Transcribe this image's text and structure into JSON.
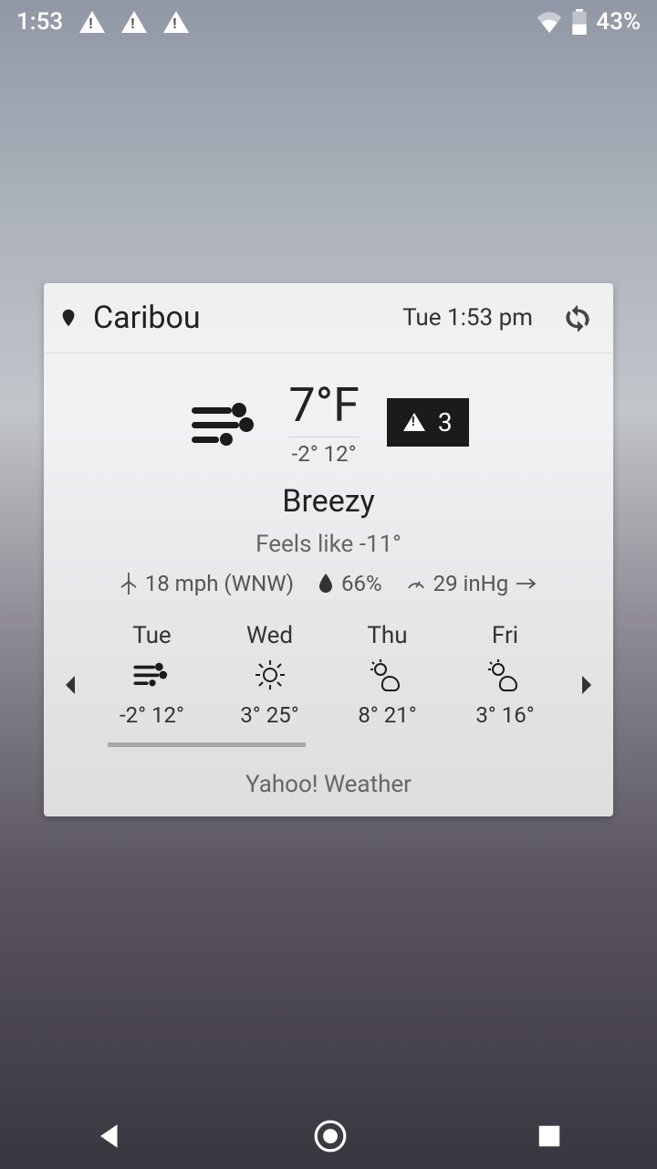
{
  "statusbar": {
    "time": "1:53",
    "battery": "43%"
  },
  "widget": {
    "location": "Caribou",
    "datetime": "Tue 1:53 pm",
    "temp": "7°F",
    "range_lo": "-2°",
    "range_hi": "12°",
    "alert_count": "3",
    "condition": "Breezy",
    "feels_like": "Feels like -11°",
    "wind": "18 mph (WNW)",
    "humidity": "66%",
    "pressure": "29 inHg",
    "provider": "Yahoo! Weather"
  },
  "forecast": [
    {
      "day": "Tue",
      "icon": "wind",
      "lo": "-2°",
      "hi": "12°"
    },
    {
      "day": "Wed",
      "icon": "sun",
      "lo": "3°",
      "hi": "25°"
    },
    {
      "day": "Thu",
      "icon": "partly",
      "lo": "8°",
      "hi": "21°"
    },
    {
      "day": "Fri",
      "icon": "partly",
      "lo": "3°",
      "hi": "16°"
    }
  ]
}
